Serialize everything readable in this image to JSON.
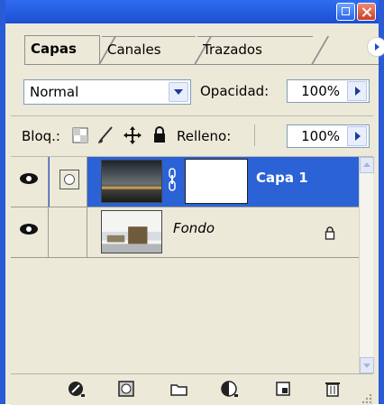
{
  "tabs": [
    {
      "label": "Capas",
      "active": true
    },
    {
      "label": "Canales",
      "active": false
    },
    {
      "label": "Trazados",
      "active": false
    }
  ],
  "blend_mode": {
    "value": "Normal"
  },
  "opacity": {
    "label": "Opacidad:",
    "value": "100%"
  },
  "lock": {
    "label": "Bloq.:",
    "icons": [
      "lock-transparent-icon",
      "lock-brush-icon",
      "lock-move-icon",
      "lock-all-icon"
    ]
  },
  "fill": {
    "label": "Relleno:",
    "value": "100%"
  },
  "layers": [
    {
      "name": "Capa 1",
      "selected": true,
      "has_mask": true,
      "visible": true
    },
    {
      "name": "Fondo",
      "selected": false,
      "locked": true,
      "visible": true
    }
  ],
  "toolbar_icons": [
    "link-layers-icon",
    "add-mask-icon",
    "new-group-icon",
    "adjustment-layer-icon",
    "new-layer-icon",
    "trash-icon"
  ],
  "colors": {
    "selection": "#2b62d6",
    "titlebar": "#2f6cf0",
    "panel": "#ece9d8"
  }
}
